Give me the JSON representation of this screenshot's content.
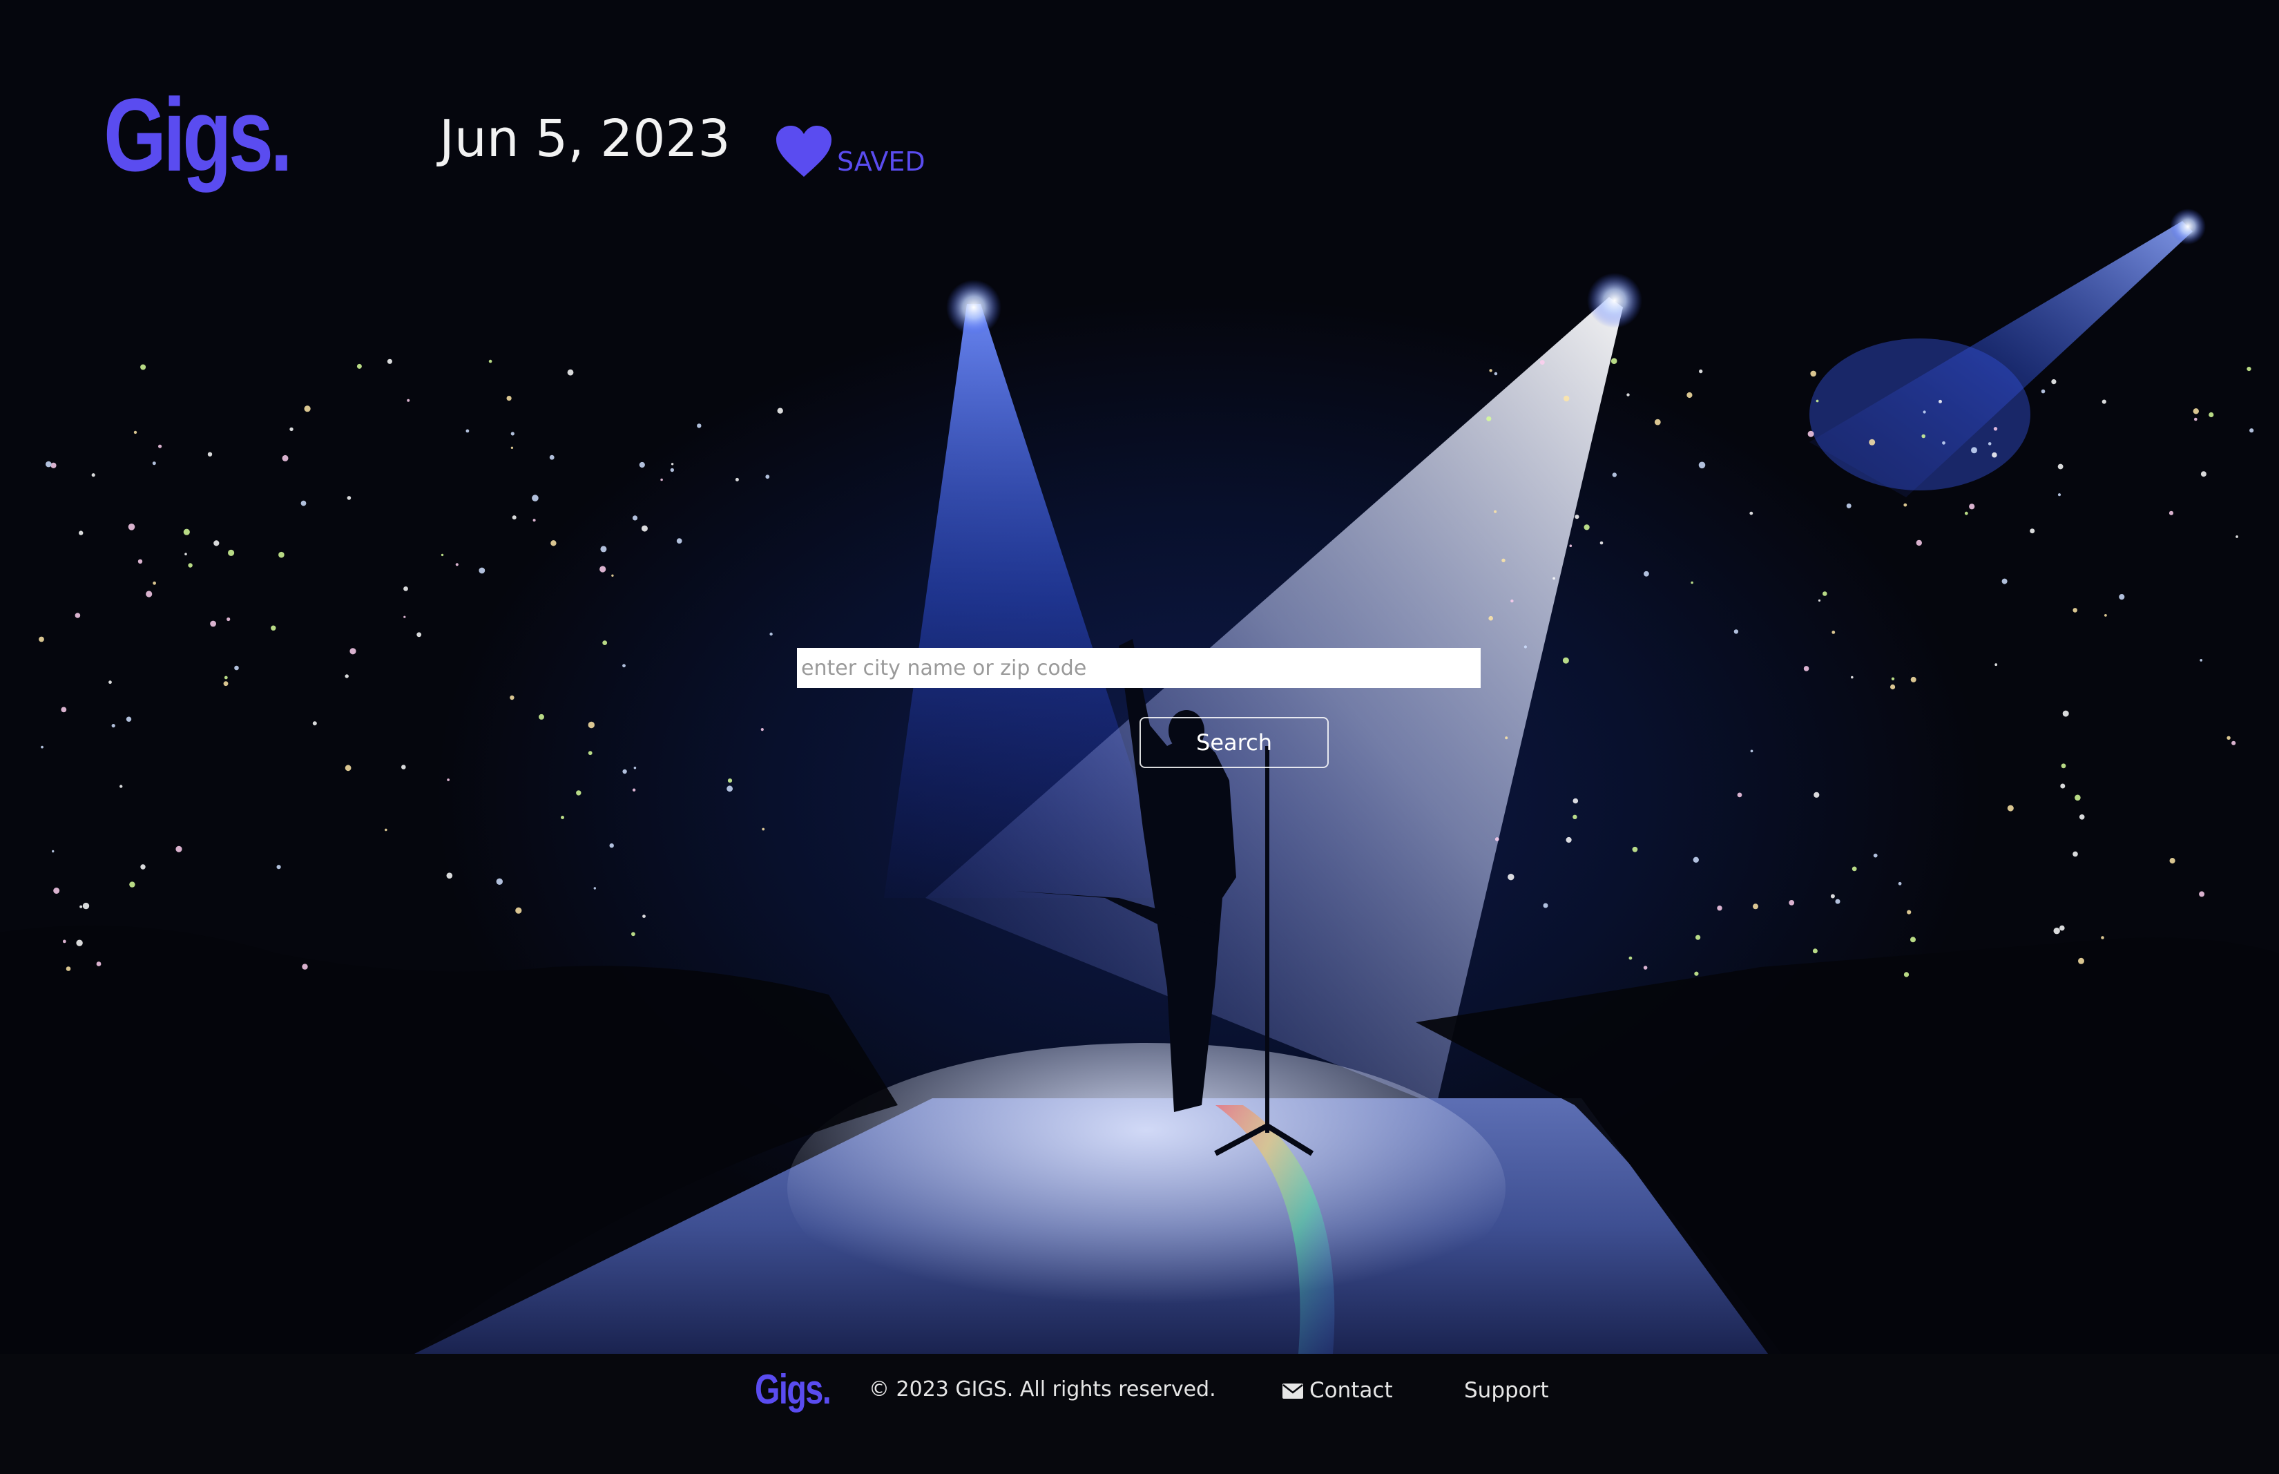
{
  "header": {
    "logo_text": "Gigs.",
    "date": "Jun 5, 2023",
    "saved_label": "SAVED",
    "saved_icon": "heart-icon"
  },
  "search": {
    "placeholder": "enter city name or zip code",
    "value": "",
    "button_label": "Search"
  },
  "footer": {
    "logo_text": "Gigs.",
    "copyright": "© 2023 GIGS. All rights reserved.",
    "contact_label": "Contact",
    "contact_icon": "mail-icon",
    "support_label": "Support"
  },
  "colors": {
    "brand": "#5a4cf0",
    "background": "#07080d",
    "text": "#f2f2f2"
  }
}
